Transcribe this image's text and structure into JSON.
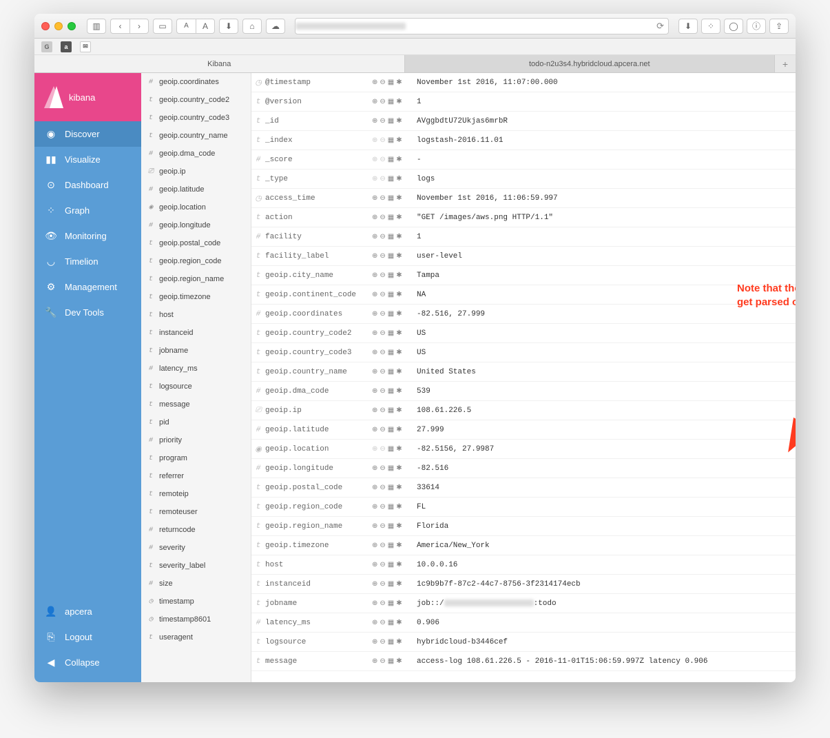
{
  "browser": {
    "tabs": [
      "Kibana",
      "todo-n2u3s4.hybridcloud.apcera.net"
    ],
    "favicons": [
      "G",
      "a",
      "✉"
    ]
  },
  "logo": "kibana",
  "nav": [
    {
      "icon": "◉",
      "label": "Discover",
      "active": true
    },
    {
      "icon": "▮▮",
      "label": "Visualize"
    },
    {
      "icon": "⊙",
      "label": "Dashboard"
    },
    {
      "icon": "⁘",
      "label": "Graph"
    },
    {
      "icon": "👁",
      "label": "Monitoring"
    },
    {
      "icon": "◡",
      "label": "Timelion"
    },
    {
      "icon": "⚙",
      "label": "Management"
    },
    {
      "icon": "🔧",
      "label": "Dev Tools"
    }
  ],
  "nav_bottom": [
    {
      "icon": "👤",
      "label": "apcera"
    },
    {
      "icon": "⎘",
      "label": "Logout"
    },
    {
      "icon": "◀",
      "label": "Collapse"
    }
  ],
  "fields": [
    {
      "t": "#",
      "name": "geoip.coordinates"
    },
    {
      "t": "t",
      "name": "geoip.country_code2"
    },
    {
      "t": "t",
      "name": "geoip.country_code3"
    },
    {
      "t": "t",
      "name": "geoip.country_name"
    },
    {
      "t": "#",
      "name": "geoip.dma_code"
    },
    {
      "t": "⎚",
      "name": "geoip.ip"
    },
    {
      "t": "#",
      "name": "geoip.latitude"
    },
    {
      "t": "◉",
      "name": "geoip.location"
    },
    {
      "t": "#",
      "name": "geoip.longitude"
    },
    {
      "t": "t",
      "name": "geoip.postal_code"
    },
    {
      "t": "t",
      "name": "geoip.region_code"
    },
    {
      "t": "t",
      "name": "geoip.region_name"
    },
    {
      "t": "t",
      "name": "geoip.timezone"
    },
    {
      "t": "t",
      "name": "host"
    },
    {
      "t": "t",
      "name": "instanceid"
    },
    {
      "t": "t",
      "name": "jobname"
    },
    {
      "t": "#",
      "name": "latency_ms"
    },
    {
      "t": "t",
      "name": "logsource"
    },
    {
      "t": "t",
      "name": "message"
    },
    {
      "t": "t",
      "name": "pid"
    },
    {
      "t": "#",
      "name": "priority"
    },
    {
      "t": "t",
      "name": "program"
    },
    {
      "t": "t",
      "name": "referrer"
    },
    {
      "t": "t",
      "name": "remoteip"
    },
    {
      "t": "t",
      "name": "remoteuser"
    },
    {
      "t": "#",
      "name": "returncode"
    },
    {
      "t": "#",
      "name": "severity"
    },
    {
      "t": "t",
      "name": "severity_label"
    },
    {
      "t": "#",
      "name": "size"
    },
    {
      "t": "◷",
      "name": "timestamp"
    },
    {
      "t": "◷",
      "name": "timestamp8601"
    },
    {
      "t": "t",
      "name": "useragent"
    }
  ],
  "doc": [
    {
      "t": "◷",
      "name": "@timestamp",
      "val": "November 1st 2016, 11:07:00.000",
      "dim": false
    },
    {
      "t": "t",
      "name": "@version",
      "val": "1"
    },
    {
      "t": "t",
      "name": "_id",
      "val": "AVggbdtU72Ukjas6mrbR"
    },
    {
      "t": "t",
      "name": "_index",
      "val": "logstash-2016.11.01",
      "dim": true
    },
    {
      "t": "#",
      "name": "_score",
      "val": "-",
      "dim": true
    },
    {
      "t": "t",
      "name": "_type",
      "val": "logs",
      "dim": true
    },
    {
      "t": "◷",
      "name": "access_time",
      "val": "November 1st 2016, 11:06:59.997"
    },
    {
      "t": "t",
      "name": "action",
      "val": "\"GET /images/aws.png HTTP/1.1\""
    },
    {
      "t": "#",
      "name": "facility",
      "val": "1"
    },
    {
      "t": "t",
      "name": "facility_label",
      "val": "user-level"
    },
    {
      "t": "t",
      "name": "geoip.city_name",
      "val": "Tampa"
    },
    {
      "t": "t",
      "name": "geoip.continent_code",
      "val": "NA"
    },
    {
      "t": "#",
      "name": "geoip.coordinates",
      "val": "-82.516, 27.999"
    },
    {
      "t": "t",
      "name": "geoip.country_code2",
      "val": "US"
    },
    {
      "t": "t",
      "name": "geoip.country_code3",
      "val": "US"
    },
    {
      "t": "t",
      "name": "geoip.country_name",
      "val": "United States"
    },
    {
      "t": "#",
      "name": "geoip.dma_code",
      "val": "539"
    },
    {
      "t": "⎚",
      "name": "geoip.ip",
      "val": "108.61.226.5"
    },
    {
      "t": "#",
      "name": "geoip.latitude",
      "val": "27.999"
    },
    {
      "t": "◉",
      "name": "geoip.location",
      "val": "-82.5156, 27.9987",
      "dim": true
    },
    {
      "t": "#",
      "name": "geoip.longitude",
      "val": "-82.516"
    },
    {
      "t": "t",
      "name": "geoip.postal_code",
      "val": "33614"
    },
    {
      "t": "t",
      "name": "geoip.region_code",
      "val": "FL"
    },
    {
      "t": "t",
      "name": "geoip.region_name",
      "val": "Florida"
    },
    {
      "t": "t",
      "name": "geoip.timezone",
      "val": "America/New_York"
    },
    {
      "t": "t",
      "name": "host",
      "val": "10.0.0.16"
    },
    {
      "t": "t",
      "name": "instanceid",
      "val": "1c9b9b7f-87c2-44c7-8756-3f2314174ecb"
    },
    {
      "t": "t",
      "name": "jobname",
      "val": "job::/",
      "blur": true,
      "suffix": ":todo"
    },
    {
      "t": "#",
      "name": "latency_ms",
      "val": "0.906"
    },
    {
      "t": "t",
      "name": "logsource",
      "val": "hybridcloud-b3446cef"
    },
    {
      "t": "t",
      "name": "message",
      "val": "access-log 108.61.226.5 - 2016-11-01T15:06:59.997Z latency 0.906"
    }
  ],
  "annotation": "Note that the fields which we specified in our grok filter get parsed out as discrete fields"
}
